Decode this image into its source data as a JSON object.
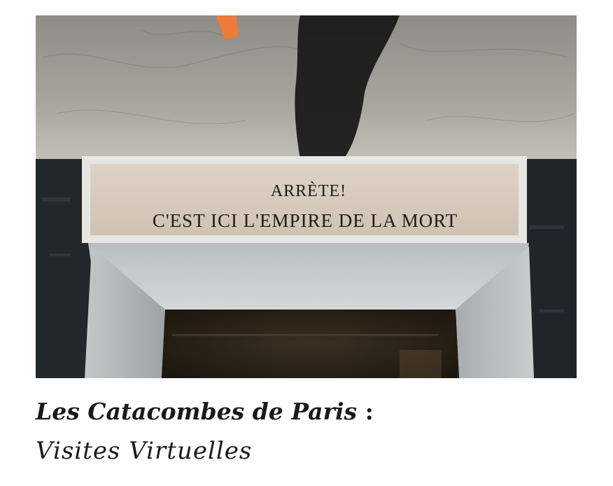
{
  "photo": {
    "subject": "Stone lintel inscription above a doorway in the Paris catacombs",
    "inscription": {
      "line1": "ARRÈTE!",
      "line2": "C'EST ICI L'EMPIRE DE LA MORT"
    }
  },
  "caption": {
    "title": "Les Catacombes de Paris",
    "title_separator": ":",
    "subtitle": "Visites Virtuelles"
  }
}
